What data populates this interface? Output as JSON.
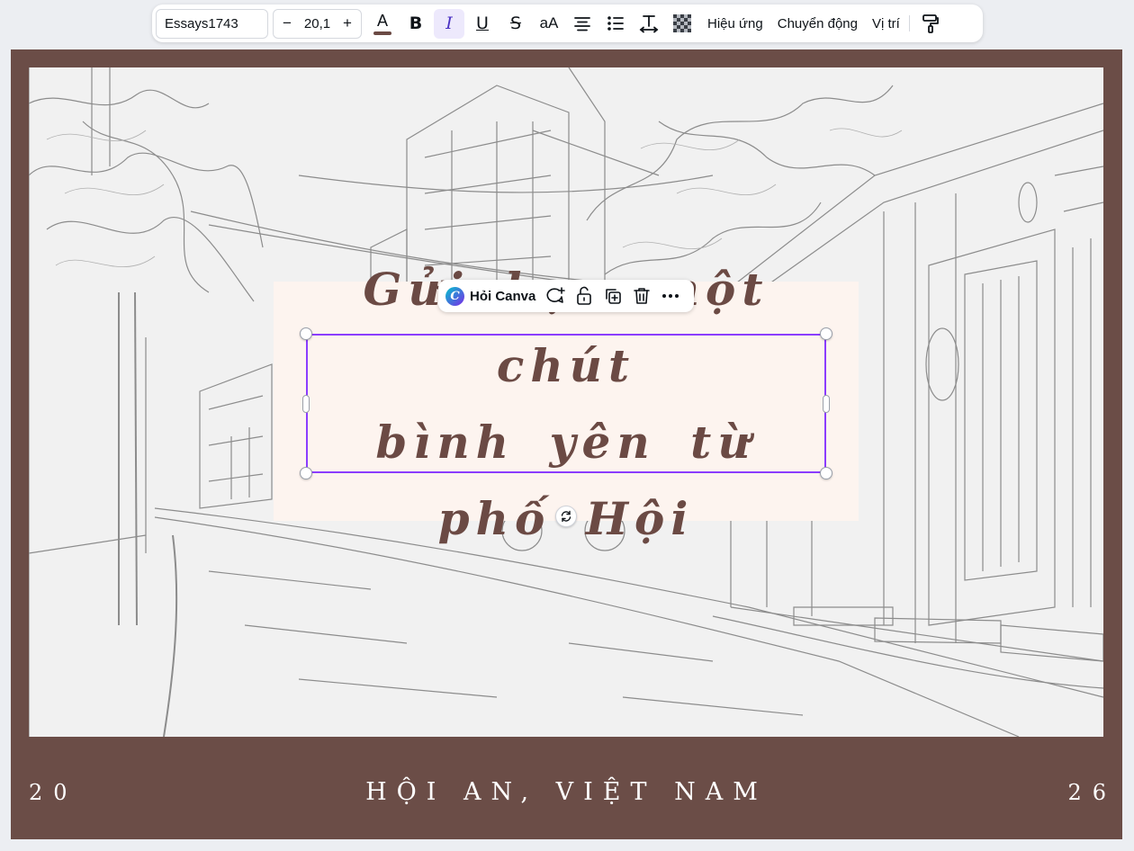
{
  "toolbar": {
    "font_name": "Essays1743",
    "font_size": "20,1",
    "decrease_label": "−",
    "increase_label": "+",
    "text_color_letter": "A",
    "text_color": "#6b4a44",
    "bold_label": "B",
    "italic_label": "I",
    "underline_label": "U",
    "strike_label": "S",
    "case_label": "aA",
    "effects_label": "Hiệu ứng",
    "animate_label": "Chuyển động",
    "position_label": "Vị trí"
  },
  "context_menu": {
    "ask_label": "Hỏi Canva",
    "logo_letter": "C"
  },
  "design": {
    "frame_color": "#6b4d47",
    "card_color": "#fdf4ef",
    "quote_line1": "Gửi bạn một chút",
    "quote_line2": "bình yên từ phố Hội",
    "year_left": "20",
    "place": "HỘI AN, VIỆT NAM",
    "year_right": "26"
  },
  "colors": {
    "accent": "#8b3dff",
    "quote_text": "#6b4a44"
  }
}
